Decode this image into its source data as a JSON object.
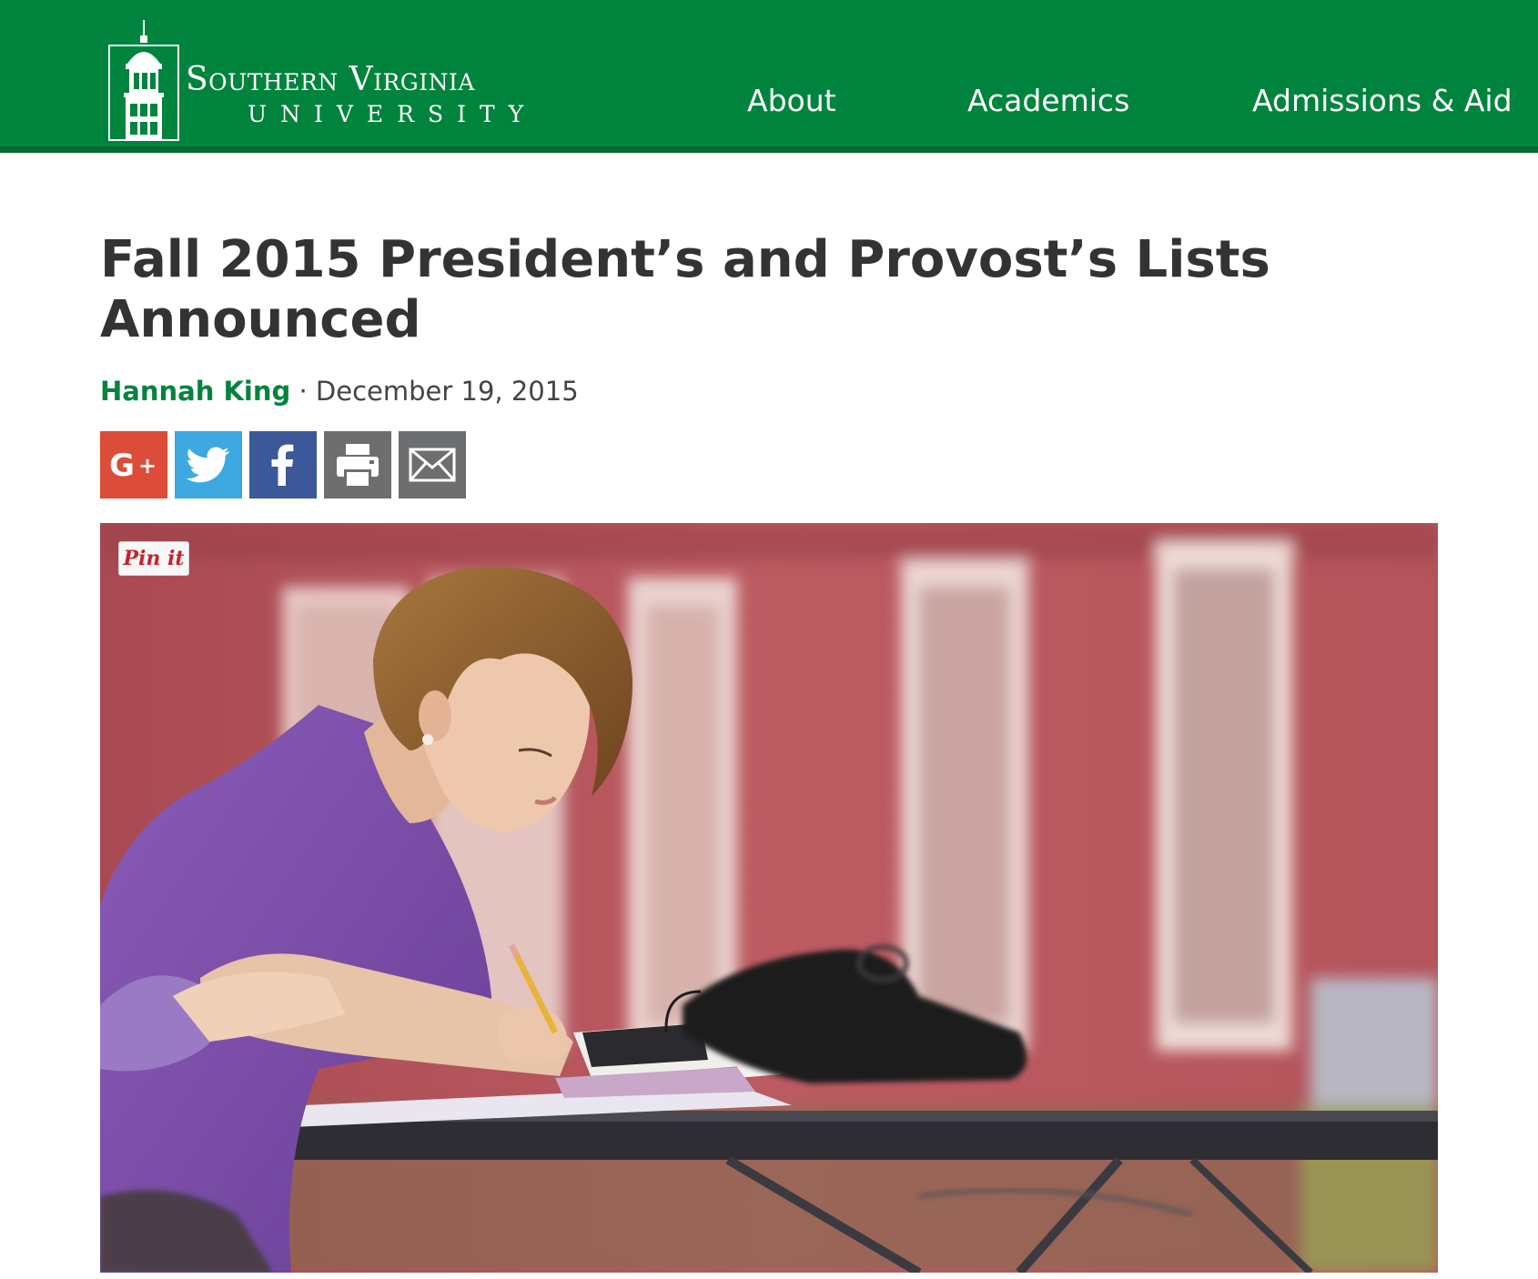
{
  "header": {
    "logo": {
      "line1": "Southern Virginia",
      "line2": "UNIVERSITY"
    },
    "nav": [
      {
        "label": "About"
      },
      {
        "label": "Academics"
      },
      {
        "label": "Admissions & Aid"
      }
    ]
  },
  "article": {
    "title": "Fall 2015 President’s and Provost’s Lists Announced",
    "author": "Hannah King",
    "separator": " · ",
    "date": "December 19, 2015"
  },
  "share": [
    {
      "icon": "google-plus-icon",
      "color": "#dd4b39"
    },
    {
      "icon": "twitter-icon",
      "color": "#3ea8e0"
    },
    {
      "icon": "facebook-icon",
      "color": "#3b5998"
    },
    {
      "icon": "print-icon",
      "color": "#6d6e70"
    },
    {
      "icon": "email-icon",
      "color": "#6d6e70"
    }
  ],
  "photo": {
    "pin_label": "Pin it"
  },
  "colors": {
    "brand_green": "#00843d",
    "header_border": "#046a32"
  }
}
